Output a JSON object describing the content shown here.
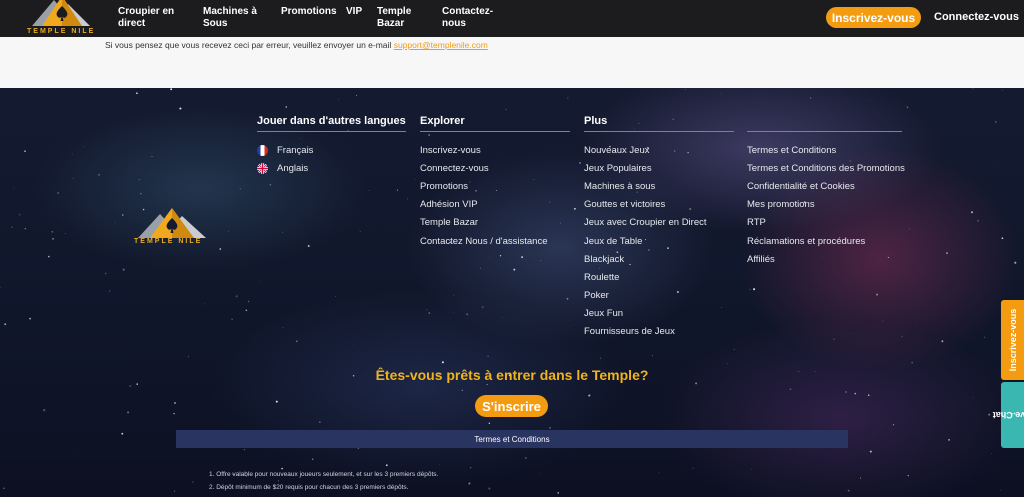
{
  "brand": {
    "logo_text": "TEMPLE NILE",
    "accent": "#f39c12"
  },
  "nav": {
    "items": [
      {
        "label": "Croupier en\ndirect"
      },
      {
        "label": "Machines à\nSous"
      },
      {
        "label": "Promotions"
      },
      {
        "label": "VIP"
      },
      {
        "label": "Temple\nBazar"
      },
      {
        "label": "Contactez-\nnous"
      }
    ],
    "signup_label": "Inscrivez-vous",
    "login_label": "Connectez-vous"
  },
  "notice": {
    "text": "Si vous pensez que vous recevez ceci par erreur, veuillez envoyer un e-mail ",
    "email": "support@templenile.com"
  },
  "footer": {
    "columns": [
      {
        "title": "Jouer dans d'autres langues",
        "items": [
          {
            "label": "Français",
            "flag": "fr-flag-icon"
          },
          {
            "label": "Anglais",
            "flag": "uk-flag-icon"
          }
        ]
      },
      {
        "title": "Explorer",
        "items": [
          "Inscrivez-vous",
          "Connectez-vous",
          "Promotions",
          "Adhésion VIP",
          "Temple Bazar",
          "Contactez Nous / d'assistance"
        ]
      },
      {
        "title": "Plus",
        "items": [
          "Nouveaux Jeux",
          "Jeux Populaires",
          "Machines à sous",
          "Gouttes et victoires",
          "Jeux avec Croupier en Direct",
          "Jeux de Table",
          "Blackjack",
          "Roulette",
          "Poker",
          "Jeux Fun",
          "Fournisseurs de Jeux"
        ]
      },
      {
        "title": "",
        "items": [
          "Termes et Conditions",
          "Termes et Conditions des Promotions",
          "Confidentialité et Cookies",
          "Mes promotions",
          "RTP",
          "Réclamations et procédures",
          "Affiliés"
        ]
      }
    ],
    "cta_title": "Êtes-vous prêts à entrer dans le Temple?",
    "cta_button": "S'inscrire",
    "terms_label": "Termes et Conditions",
    "terms": [
      "1. Offre valable pour nouveaux joueurs seulement, et sur les 3 premiers dépôts.",
      "2. Dépôt minimum de $20 requis pour chacun des 3 premiers dépôts."
    ]
  },
  "side_tabs": {
    "signup": "Inscrivez-vous",
    "chat": "Live Chat"
  }
}
